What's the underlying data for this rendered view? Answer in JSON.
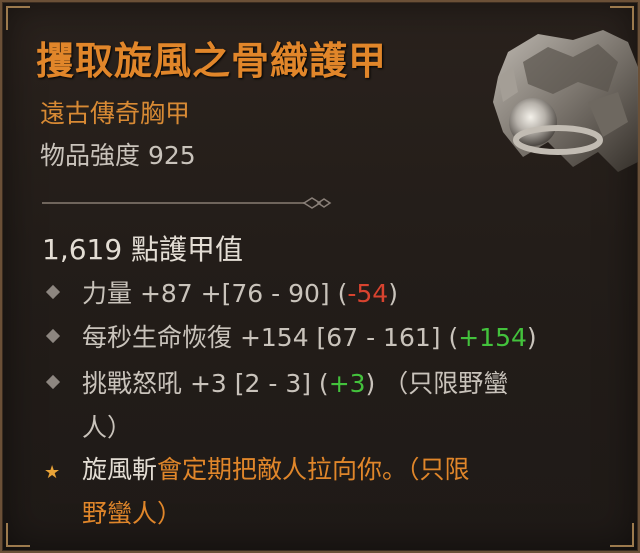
{
  "item": {
    "name": "攫取旋風之骨織護甲",
    "rarity": "遠古傳奇胸甲",
    "power_label": "物品強度 925",
    "armor": "1,619 點護甲值",
    "colors": {
      "title": "#e1862a",
      "rarity": "#d88a34",
      "negative": "#d8432f",
      "positive": "#43c23c",
      "body_text": "#c9c3bb"
    },
    "affixes": [
      {
        "name": "力量 +87 +[76 - 90] (",
        "delta": "-54",
        "close": ")",
        "delta_type": "negative"
      },
      {
        "name": "每秒生命恢復 +154 [67 - 161] (",
        "delta": "+154",
        "close": ")",
        "delta_type": "positive"
      },
      {
        "name": "挑戰怒吼 +3 [2 - 3] (",
        "delta": "+3",
        "close": ") （只限野蠻",
        "tail": "人）",
        "delta_type": "positive"
      }
    ],
    "legendary_power": {
      "skill": "旋風斬",
      "text": "會定期把敵人拉向你。（只限",
      "tail": "野蠻人）"
    }
  },
  "icons": {
    "bullet": "diamond-bullet-icon",
    "legendary": "star-icon",
    "divider": "ornament-divider-icon",
    "item": "chest-armor-icon"
  }
}
